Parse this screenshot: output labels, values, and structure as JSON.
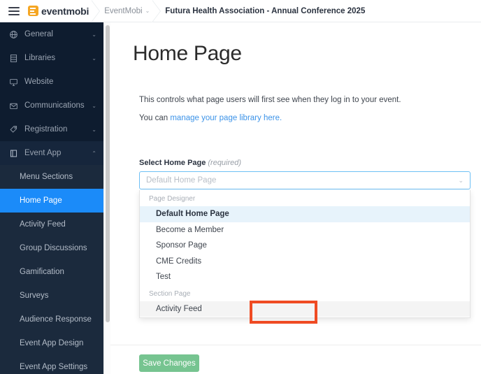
{
  "topbar": {
    "menu_icon": "hamburger-icon",
    "brand": "eventmobi",
    "breadcrumbs": [
      {
        "label": "EventMobi",
        "caret": "⌄",
        "active": false
      },
      {
        "label": "Futura Health Association - Annual Conference 2025",
        "active": true
      }
    ]
  },
  "sidebar": {
    "items": [
      {
        "label": "General",
        "icon": "globe-icon",
        "caret": "⌄",
        "expanded": false
      },
      {
        "label": "Libraries",
        "icon": "library-icon",
        "caret": "⌄",
        "expanded": false
      },
      {
        "label": "Website",
        "icon": "monitor-icon",
        "caret": "",
        "expanded": false
      },
      {
        "label": "Communications",
        "icon": "envelope-icon",
        "caret": "⌄",
        "expanded": false
      },
      {
        "label": "Registration",
        "icon": "tag-icon",
        "caret": "⌄",
        "expanded": false
      },
      {
        "label": "Event App",
        "icon": "app-icon",
        "caret": "⌃",
        "expanded": true
      }
    ],
    "subitems": [
      {
        "label": "Menu Sections",
        "selected": false
      },
      {
        "label": "Home Page",
        "selected": true
      },
      {
        "label": "Activity Feed",
        "selected": false
      },
      {
        "label": "Group Discussions",
        "selected": false
      },
      {
        "label": "Gamification",
        "selected": false
      },
      {
        "label": "Surveys",
        "selected": false
      },
      {
        "label": "Audience Response",
        "selected": false
      },
      {
        "label": "Event App Design",
        "selected": false
      },
      {
        "label": "Event App Settings",
        "selected": false
      }
    ]
  },
  "main": {
    "title": "Home Page",
    "intro_line1": "This controls what page users will first see when they log in to your event.",
    "intro_line2_prefix": "You can ",
    "intro_line2_link": "manage your page library here.",
    "field_label": "Select Home Page",
    "field_required_note": "(required)",
    "select_value": "Default Home Page",
    "select_chevron": "⌄",
    "dropdown": {
      "groups": [
        {
          "group_label": "Page Designer",
          "options": [
            {
              "label": "Default Home Page",
              "state": "current"
            },
            {
              "label": "Become a Member",
              "state": "normal"
            },
            {
              "label": "Sponsor Page",
              "state": "normal"
            },
            {
              "label": "CME Credits",
              "state": "normal"
            },
            {
              "label": "Test",
              "state": "normal"
            }
          ]
        },
        {
          "group_label": "Section Page",
          "options": [
            {
              "label": "Activity Feed",
              "state": "hovered"
            }
          ]
        }
      ]
    },
    "save_label": "Save Changes"
  },
  "colors": {
    "sidebar_bg": "#0e1c2f",
    "subnav_bg": "#1b2a3d",
    "accent_blue": "#1b8bf9",
    "link_blue": "#3c93e8",
    "brand_orange": "#f5a623",
    "highlight_red": "#ef4b23",
    "save_green": "#76c490",
    "option_current_bg": "#e7f3fb"
  }
}
